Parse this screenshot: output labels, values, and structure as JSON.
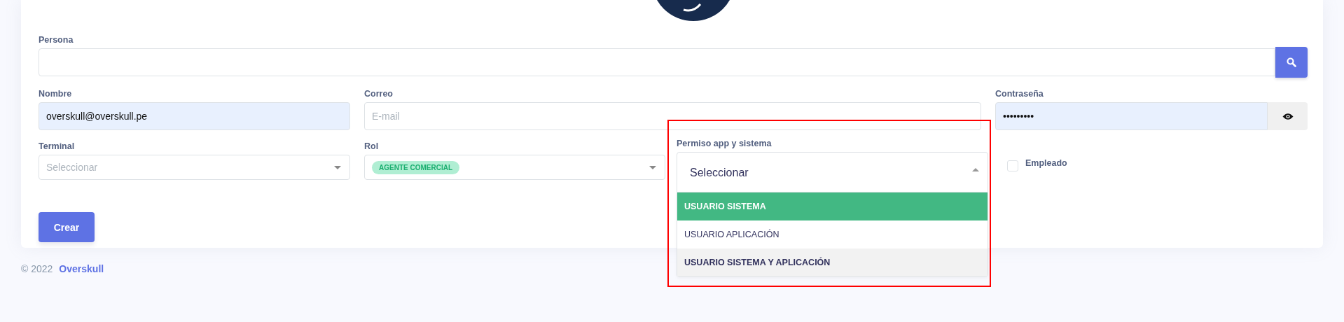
{
  "persona": {
    "label": "Persona"
  },
  "nombre": {
    "label": "Nombre",
    "value": "overskull@overskull.pe"
  },
  "correo": {
    "label": "Correo",
    "placeholder": "E-mail"
  },
  "contrasena": {
    "label": "Contraseña",
    "value": "•••••••••"
  },
  "terminal": {
    "label": "Terminal",
    "placeholder": "Seleccionar"
  },
  "rol": {
    "label": "Rol",
    "tags": [
      "AGENTE COMERCIAL"
    ]
  },
  "permiso": {
    "label": "Permiso app y sistema",
    "placeholder": "Seleccionar",
    "expanded": true,
    "highlighted": true,
    "options": [
      {
        "label": "USUARIO SISTEMA",
        "selected": true,
        "hovered": false
      },
      {
        "label": "USUARIO APLICACIÓN",
        "selected": false,
        "hovered": false
      },
      {
        "label": "USUARIO SISTEMA Y APLICACIÓN",
        "selected": false,
        "hovered": true
      }
    ]
  },
  "empleado": {
    "label": "Empleado",
    "checked": false
  },
  "submit": "Crear",
  "footer": {
    "copyright": "© 2022",
    "brand": "Overskull"
  }
}
